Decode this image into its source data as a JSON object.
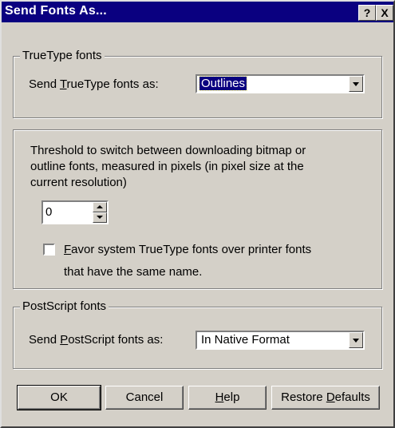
{
  "window": {
    "title": "Send Fonts As...",
    "help_button": "?",
    "close_button": "X"
  },
  "truetype_group": {
    "legend": "TrueType fonts",
    "label_pre": "Send ",
    "label_accel": "T",
    "label_post": "rueType fonts as:",
    "selected": "Outlines"
  },
  "threshold_group": {
    "description_line1": "Threshold to switch between downloading bitmap or",
    "description_line2": "outline fonts, measured in pixels (in pixel size at the",
    "description_line3": "current resolution)",
    "spinner_value": "0",
    "checkbox_accel": "F",
    "checkbox_line1_rest": "avor system TrueType fonts over printer fonts",
    "checkbox_line2": "that have the same name.",
    "checkbox_checked": false
  },
  "postscript_group": {
    "legend": "PostScript fonts",
    "label_pre": "Send ",
    "label_accel": "P",
    "label_post": "ostScript fonts as:",
    "selected": "In Native Format"
  },
  "buttons": {
    "ok": "OK",
    "cancel": "Cancel",
    "help_accel": "H",
    "help_rest": "elp",
    "restore_pre": "Restore ",
    "restore_accel": "D",
    "restore_post": "efaults"
  },
  "colors": {
    "titlebar": "#0a0080",
    "face": "#d4d0c8"
  }
}
